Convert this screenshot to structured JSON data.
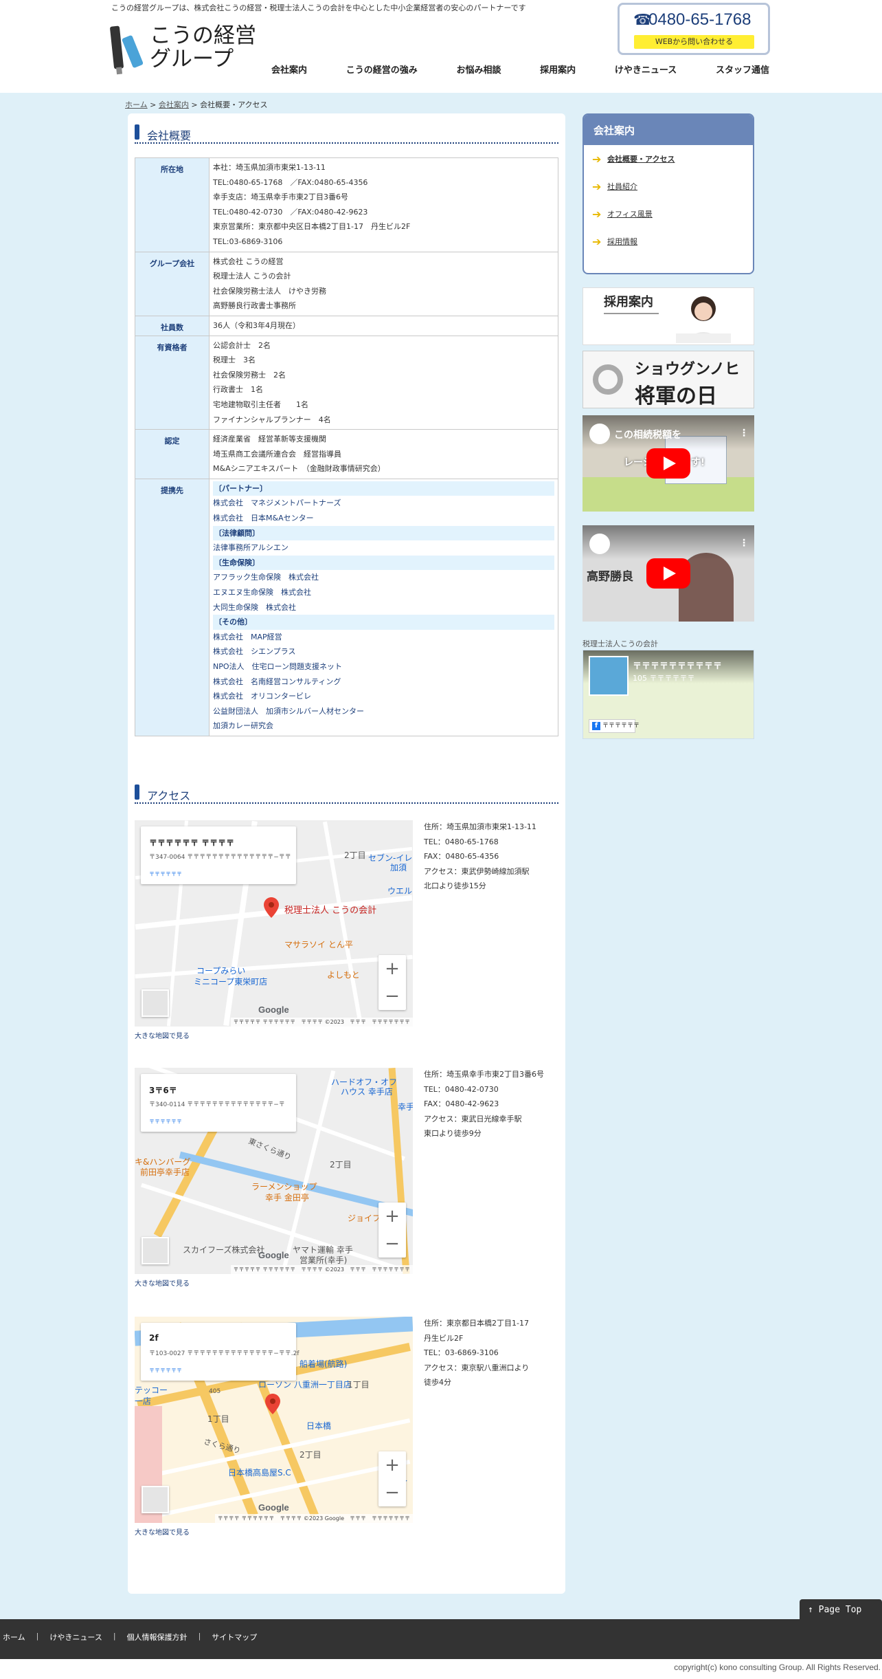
{
  "header": {
    "tagline": "こうの経営グループは、株式会社こうの経営・税理士法人こうの会計を中心とした中小企業経営者の安心のパートナーです",
    "logo_line1": "こうの経営",
    "logo_line2": "グループ",
    "tel": "0480-65-1768",
    "web_contact": "WEBから問い合わせる",
    "nav": [
      "会社案内",
      "こうの経営の強み",
      "お悩み相談",
      "採用案内",
      "けやきニュース",
      "スタッフ通信"
    ]
  },
  "breadcrumb": {
    "home": "ホーム",
    "sep": ">",
    "company": "会社案内",
    "current": "会社概要・アクセス"
  },
  "company": {
    "title": "会社概要",
    "rows": [
      {
        "label": "所在地",
        "lines": [
          "本社：埼玉県加須市東栄1-13-11",
          "TEL:0480-65-1768　／FAX:0480-65-4356",
          "幸手支店：埼玉県幸手市東2丁目3番6号",
          "TEL:0480-42-0730　／FAX:0480-42-9623",
          "東京営業所：東京都中央区日本橋2丁目1-17　丹生ビル2F",
          "TEL:03-6869-3106"
        ]
      },
      {
        "label": "グループ会社",
        "lines": [
          "株式会社 こうの経営",
          "税理士法人 こうの会計",
          "社会保険労務士法人　けやき労務",
          "高野勝良行政書士事務所"
        ]
      },
      {
        "label": "社員数",
        "lines": [
          "36人（令和3年4月現在）"
        ]
      },
      {
        "label": "有資格者",
        "lines": [
          "公認会計士　2名",
          "税理士　3名",
          "社会保険労務士　2名",
          "行政書士　1名",
          "宅地建物取引主任者　　1名",
          "ファイナンシャルプランナー　4名"
        ]
      },
      {
        "label": "認定",
        "lines": [
          "経済産業省　経営革新等支援機関",
          "埼玉県商工会議所連合会　経営指導員",
          "M&Aシニアエキスパート　（金融財政事情研究会）"
        ]
      }
    ],
    "partners_label": "提携先",
    "partners": [
      {
        "cat": "〔パートナー〕",
        "items": [
          "株式会社　マネジメントパートナーズ",
          "株式会社　日本M&Aセンター"
        ]
      },
      {
        "cat": "〔法律顧問〕",
        "items": [
          "法律事務所アルシエン"
        ]
      },
      {
        "cat": "〔生命保険〕",
        "items": [
          "アフラック生命保険　株式会社",
          "エヌエヌ生命保険　株式会社",
          "大同生命保険　株式会社"
        ]
      },
      {
        "cat": "〔その他〕",
        "items": [
          "株式会社　MAP経営",
          "株式会社　シエンプラス",
          "NPO法人　住宅ローン問題支援ネット",
          "株式会社　名南経営コンサルティング",
          "株式会社　オリコンタービレ",
          "公益財団法人　加須市シルバー人材センター",
          "加須カレー研究会"
        ]
      }
    ]
  },
  "access": {
    "title": "アクセス",
    "big_map_link": "大きな地図で見る",
    "maps": [
      {
        "card_name": "〒〒〒〒〒〒 〒〒〒〒",
        "card_addr": "〒347-0064 〒〒〒〒〒〒〒〒〒〒〒〒〒〒−〒〒",
        "card_link": "〒〒〒〒〒〒",
        "marker_label": "税理士法人 こうの会計",
        "pois": [
          "マサラソイ とん平",
          "コープみらい",
          "ミニコープ東栄町店",
          "よしもと",
          "セブン-イレ",
          "加須",
          "ウエル",
          "2丁目"
        ],
        "attribution": "〒〒〒〒〒 〒〒〒〒〒〒　〒〒〒〒 ©2023　〒〒〒　〒〒〒〒〒〒〒",
        "lines": [
          "住所：埼玉県加須市東栄1-13-11",
          "TEL：0480-65-1768",
          "FAX：0480-65-4356",
          "アクセス：東武伊勢崎線加須駅",
          "北口より徒歩15分"
        ]
      },
      {
        "card_name": "3〒6〒",
        "card_addr": "〒340-0114 〒〒〒〒〒〒〒〒〒〒〒〒〒〒−〒",
        "card_link": "〒〒〒〒〒〒",
        "marker_label": "",
        "pois": [
          "ハードオフ・オフ",
          "ハウス 幸手店",
          "キ&ハンバーグ",
          "前田亭幸手店",
          "ラーメンショップ",
          "幸手 金田亭",
          "ジョイフル 幸",
          "スカイフーズ株式会社",
          "ヤマト運輸 幸手",
          "営業所(幸手)",
          "東さくら通り",
          "2丁目",
          "幸手"
        ],
        "attribution": "〒〒〒〒〒 〒〒〒〒〒〒　〒〒〒〒 ©2023　〒〒〒　〒〒〒〒〒〒〒",
        "lines": [
          "住所：埼玉県幸手市東2丁目3番6号",
          "TEL：0480-42-0730",
          "FAX：0480-42-9623",
          "アクセス：東武日光線幸手駅",
          "東口より徒歩9分"
        ]
      },
      {
        "card_name": "2f",
        "card_addr": "〒103-0027 〒〒〒〒〒〒〒〒〒〒〒〒〒〒−〒〒.2f",
        "card_link": "〒〒〒〒〒〒",
        "marker_label": "",
        "pois": [
          "船着場(航路)",
          "ローソン 八重洲一丁目店",
          "日本橋",
          "日本橋高島屋S.C",
          "さくら通り",
          "1丁目",
          "2丁目",
          "ディ",
          "テッコー",
          "一店",
          "1丁目",
          "405"
        ],
        "attribution": "〒〒〒〒 〒〒〒〒〒〒　〒〒〒〒 ©2023 Google　〒〒〒　〒〒〒〒〒〒〒",
        "lines": [
          "住所：東京都日本橋2丁目1-17",
          "丹生ビル2F",
          "TEL：03-6869-3106",
          "アクセス：東京駅八重洲口より",
          "徒歩4分"
        ]
      }
    ]
  },
  "sidebar": {
    "title": "会社案内",
    "items": [
      "会社概要・アクセス",
      "社員紹介",
      "オフィス風景",
      "採用情報"
    ],
    "recruit_banner": "採用案内",
    "shogun_banner_1": "ショウグンノヒ",
    "shogun_banner_2": "将軍の日",
    "fb_label": "税理士法人こうの会計",
    "fb_name": "〒〒〒〒〒〒〒〒〒〒",
    "fb_sub": "105 〒〒〒〒〒〒",
    "fb_btn": "〒〒〒〒〒〒",
    "yt1_title": "この相続税額を",
    "yt1_sub": "レーションします!",
    "yt2_title": "高野勝良"
  },
  "google": "Google",
  "page_top": "Page Top",
  "footer": {
    "links": [
      "ホーム",
      "けやきニュース",
      "個人情報保護方針",
      "サイトマップ"
    ],
    "copyright": "copyright(c) kono consulting Group. All Rights Reserved."
  }
}
